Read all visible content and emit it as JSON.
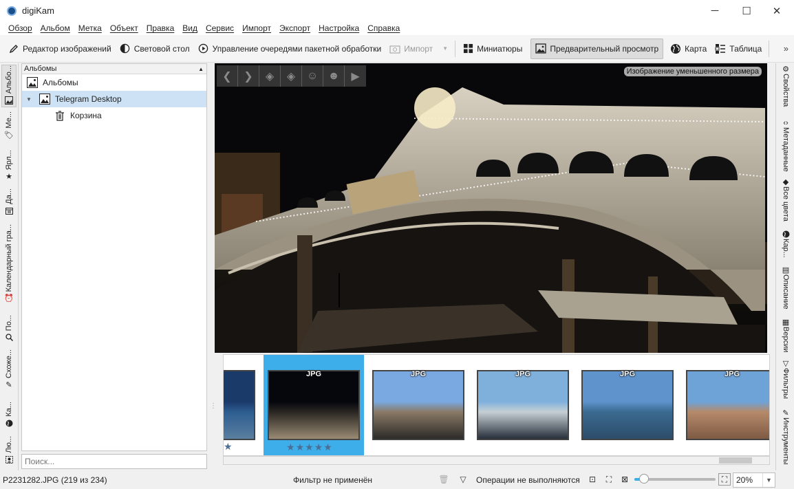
{
  "window": {
    "title": "digiKam",
    "minimize": "─",
    "maximize": "☐",
    "close": "✕"
  },
  "menu": [
    "Обзор",
    "Альбом",
    "Метка",
    "Объект",
    "Правка",
    "Вид",
    "Сервис",
    "Импорт",
    "Экспорт",
    "Настройка",
    "Справка"
  ],
  "toolbar": {
    "editor": "Редактор изображений",
    "lighttable": "Световой стол",
    "queue": "Управление очередями пакетной обработки",
    "import": "Импорт",
    "thumbnails": "Миниатюры",
    "preview": "Предварительный просмотр",
    "map": "Карта",
    "table": "Таблица",
    "more": "»"
  },
  "left_tabs": [
    "Альбо...",
    "Ме...",
    "Ярл...",
    "Да...",
    "Календарный гра...",
    "По...",
    "Схоже...",
    "Ка...",
    "Лю..."
  ],
  "albums": {
    "header": "Альбомы",
    "items": [
      {
        "label": "Альбомы"
      },
      {
        "label": "Telegram Desktop"
      },
      {
        "label": "Корзина"
      }
    ]
  },
  "search": {
    "placeholder": "Поиск..."
  },
  "preview": {
    "label": "Изображение уменьшенного размера"
  },
  "thumbnails": {
    "format": "JPG",
    "items": [
      {
        "colors": [
          "#1a3a6a",
          "#2d5d90",
          "#5a7fa0"
        ],
        "selected": false
      },
      {
        "colors": [
          "#05070d",
          "#2a2622",
          "#9a8b74"
        ],
        "selected": true,
        "rating": 5
      },
      {
        "colors": [
          "#7aa8e0",
          "#8a7a66",
          "#2c2a28"
        ],
        "selected": false
      },
      {
        "colors": [
          "#7fb0dc",
          "#c5cfd4",
          "#27303a"
        ],
        "selected": false
      },
      {
        "colors": [
          "#5e93cc",
          "#3b6a90",
          "#2d4d6a"
        ],
        "selected": false
      },
      {
        "colors": [
          "#6ea3d8",
          "#b58a6a",
          "#7e5a44"
        ],
        "selected": false
      }
    ]
  },
  "right_tabs": [
    "Свойства",
    "Метаданные",
    "Все цвета",
    "Кар...",
    "Описание",
    "Версии",
    "Фильтры",
    "Инструменты"
  ],
  "status": {
    "file": "P2231282.JPG (219 из 234)",
    "filter": "Фильтр не применён",
    "ops": "Операции не выполняются",
    "zoom": "20%",
    "zoom_level": 0.12
  },
  "colors": {
    "accent": "#3daee9",
    "selected_tree": "#cde3f5"
  }
}
